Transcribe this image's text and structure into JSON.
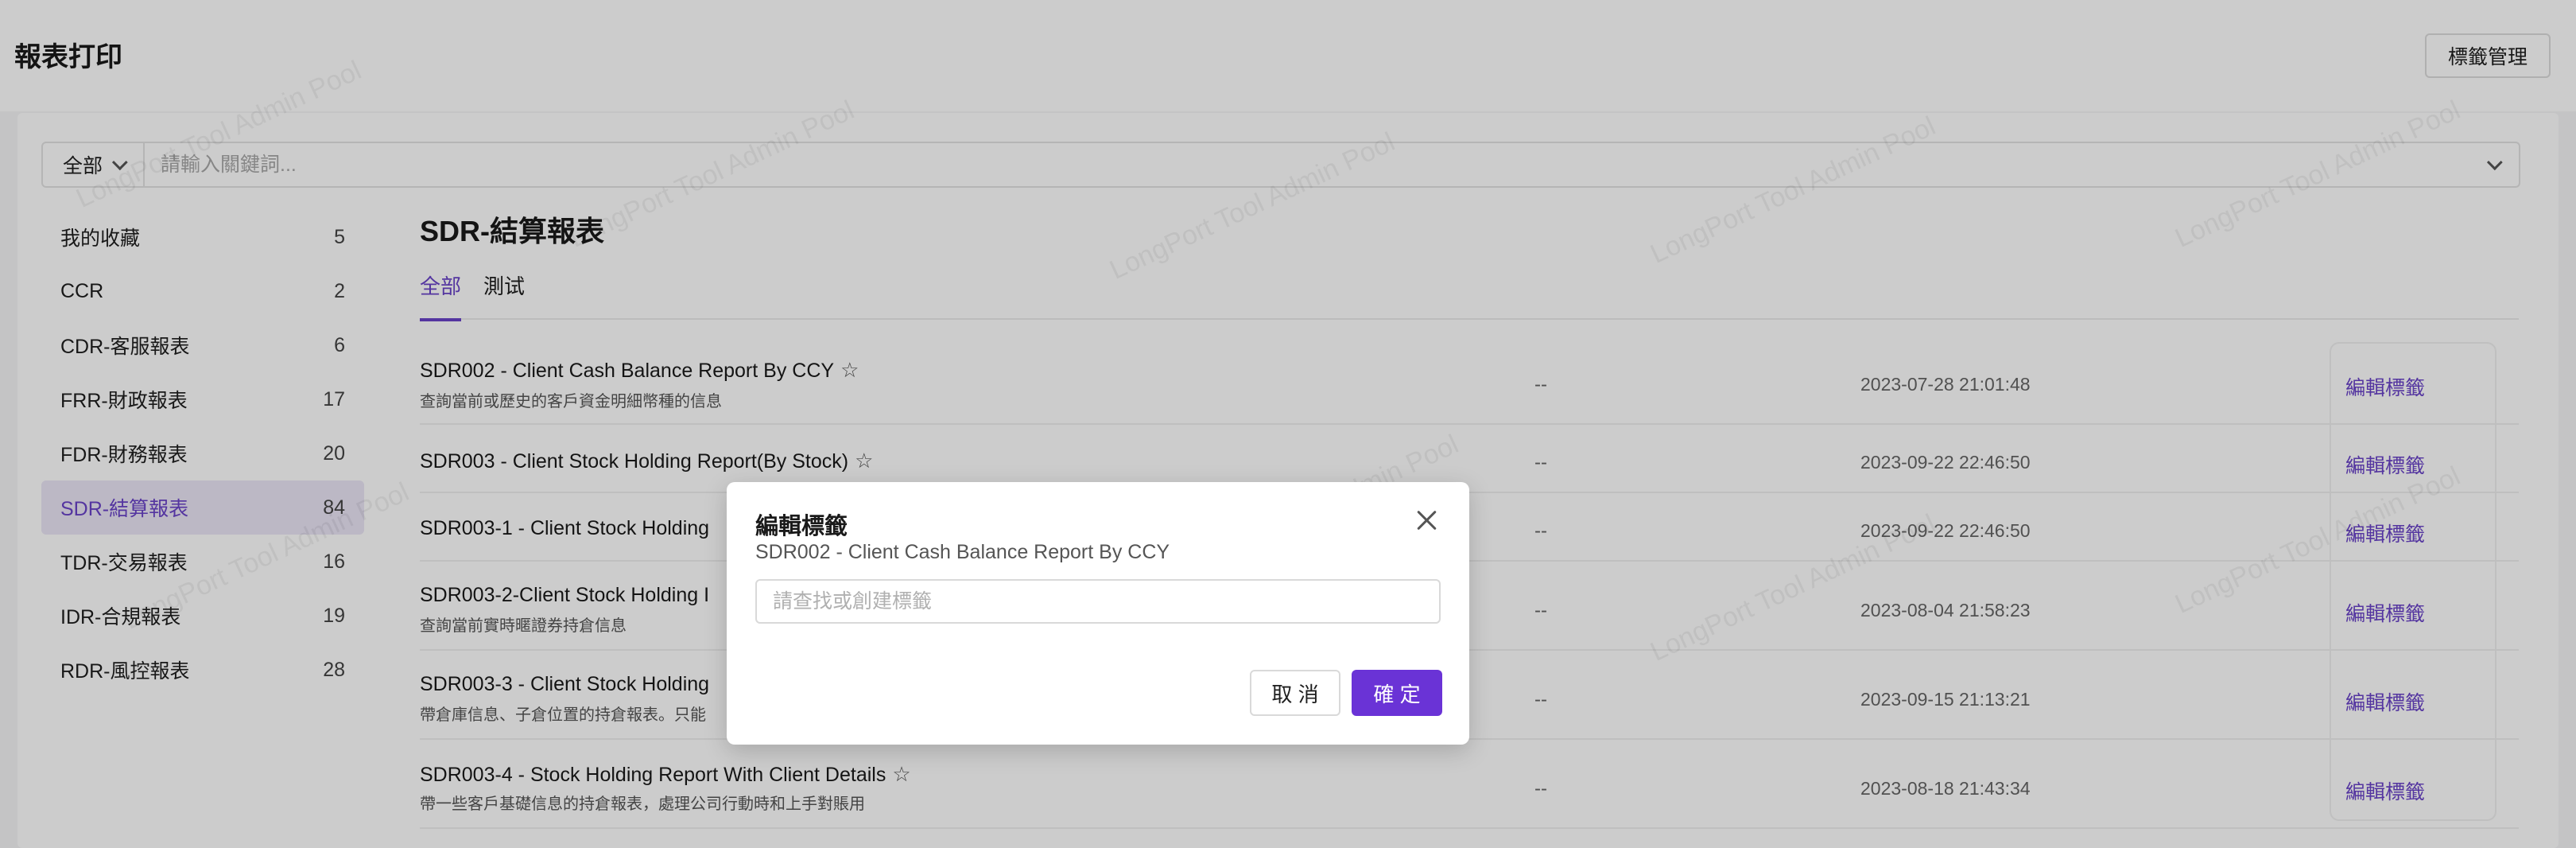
{
  "header": {
    "title": "報表打印",
    "tag_management_label": "標籤管理"
  },
  "search": {
    "scope_value": "全部",
    "placeholder": "請輸入關鍵詞..."
  },
  "sidebar": {
    "items": [
      {
        "label": "我的收藏",
        "count": "5"
      },
      {
        "label": "CCR",
        "count": "2"
      },
      {
        "label": "CDR-客服報表",
        "count": "6"
      },
      {
        "label": "FRR-財政報表",
        "count": "17"
      },
      {
        "label": "FDR-財務報表",
        "count": "20"
      },
      {
        "label": "SDR-結算報表",
        "count": "84"
      },
      {
        "label": "TDR-交易報表",
        "count": "16"
      },
      {
        "label": "IDR-合規報表",
        "count": "19"
      },
      {
        "label": "RDR-風控報表",
        "count": "28"
      }
    ]
  },
  "main": {
    "section_title": "SDR-結算報表",
    "tabs": [
      {
        "label": "全部"
      },
      {
        "label": "測试"
      }
    ],
    "rows": [
      {
        "title": "SDR002 - Client Cash Balance Report By CCY",
        "desc": "查詢當前或歷史的客戶資金明細幣種的信息",
        "tag": "--",
        "time": "2023-07-28 21:01:48",
        "action": "編輯標籤"
      },
      {
        "title": "SDR003 - Client Stock Holding Report(By Stock)",
        "desc": "",
        "tag": "--",
        "time": "2023-09-22 22:46:50",
        "action": "編輯標籤"
      },
      {
        "title": "SDR003-1 - Client Stock Holding",
        "desc": "",
        "tag": "--",
        "time": "2023-09-22 22:46:50",
        "action": "編輯標籤"
      },
      {
        "title": "SDR003-2-Client Stock Holding I",
        "desc": "查詢當前實時暱證券持倉信息",
        "tag": "--",
        "time": "2023-08-04 21:58:23",
        "action": "編輯標籤"
      },
      {
        "title": "SDR003-3 - Client Stock Holding",
        "desc": "帶倉庫信息、子倉位置的持倉報表。只能",
        "tag": "--",
        "time": "2023-09-15 21:13:21",
        "action": "編輯標籤"
      },
      {
        "title": "SDR003-4 - Stock Holding Report With Client Details",
        "desc": "帶一些客戶基礎信息的持倉報表，處理公司行動時和上手對賬用",
        "tag": "--",
        "time": "2023-08-18 21:43:34",
        "action": "編輯標籤"
      }
    ]
  },
  "watermark": {
    "text": "LongPort Tool Admin Pool"
  },
  "modal": {
    "title": "編輯標籤",
    "subtitle": "SDR002 - Client Cash Balance Report By CCY",
    "input_placeholder": "請查找或創建標籤",
    "cancel_label": "取 消",
    "ok_label": "確 定"
  },
  "colors": {
    "accent": "#6a43c9",
    "primary_button": "#6a33d6"
  }
}
